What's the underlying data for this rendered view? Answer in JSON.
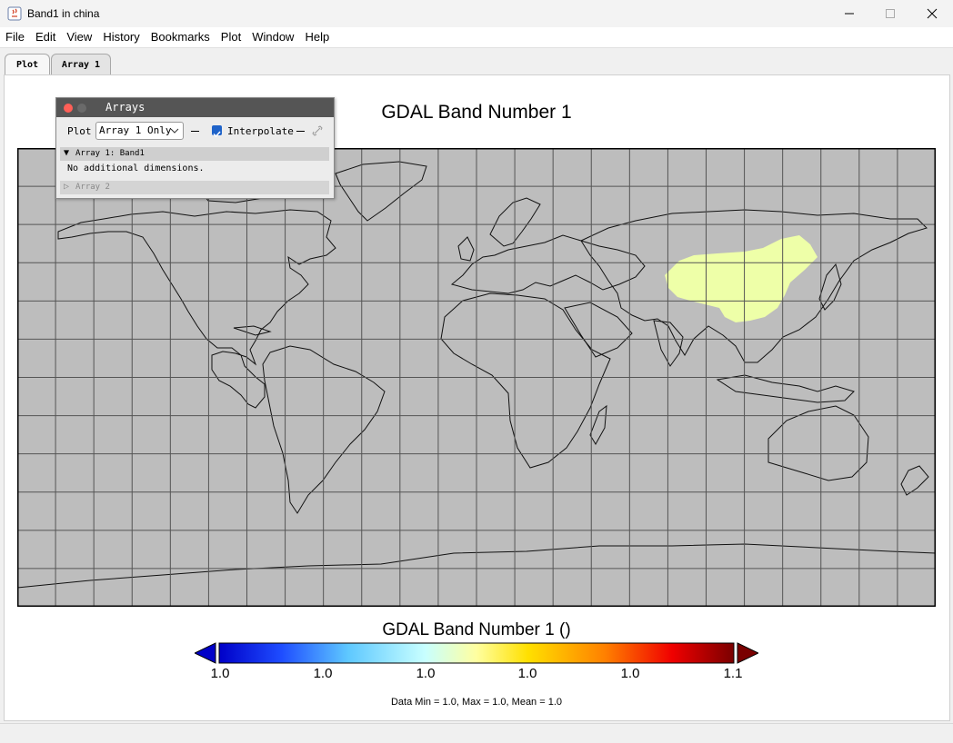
{
  "window": {
    "title": "Band1 in china"
  },
  "menu": [
    "File",
    "Edit",
    "View",
    "History",
    "Bookmarks",
    "Plot",
    "Window",
    "Help"
  ],
  "tabs": [
    {
      "label": "Plot"
    },
    {
      "label": "Array 1"
    }
  ],
  "plot": {
    "title": "GDAL Band Number 1",
    "colorbar_title": "GDAL Band Number 1 ()",
    "colorbar_ticks": [
      "1.0",
      "1.0",
      "1.0",
      "1.0",
      "1.0",
      "1.1"
    ],
    "stats": "Data Min = 1.0, Max = 1.0, Mean = 1.0"
  },
  "arrays_panel": {
    "title": "Arrays",
    "plot_label": "Plot",
    "plot_mode": "Array 1 Only",
    "interpolate_label": "Interpolate",
    "interpolate_checked": true,
    "array1_label": "Array 1: Band1",
    "array1_detail": "No additional dimensions.",
    "array2_label": "Array 2"
  },
  "colors": {
    "map_background": "#bdbdbd",
    "data_fill": "#eeffa8",
    "grid": "#555555"
  }
}
